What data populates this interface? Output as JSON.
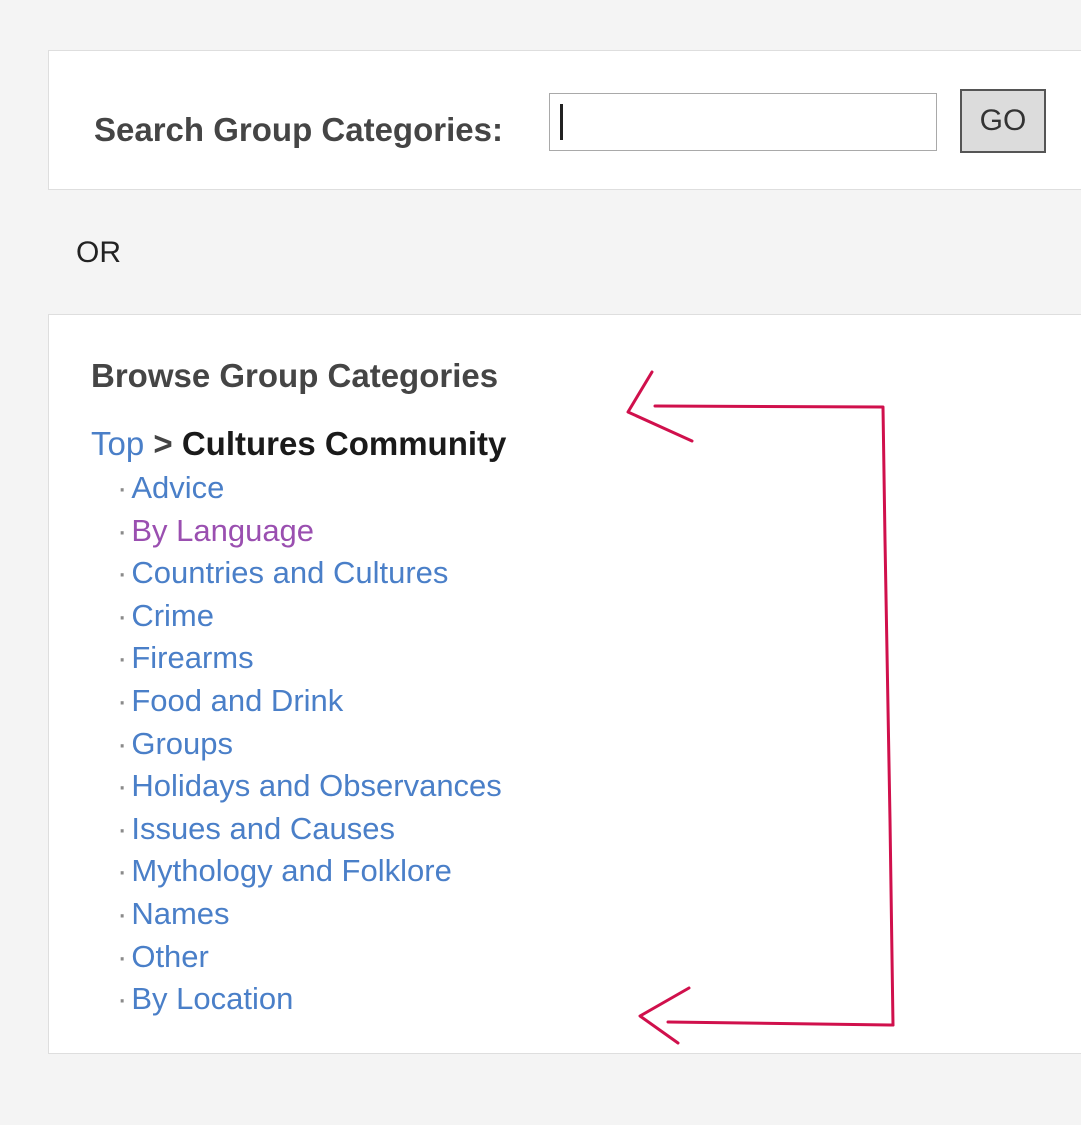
{
  "search": {
    "label": "Search Group Categories:",
    "value": "",
    "button_label": "GO"
  },
  "or_text": "OR",
  "browse": {
    "title": "Browse Group Categories",
    "breadcrumb": {
      "root": "Top",
      "separator": ">",
      "current": "Cultures Community"
    },
    "bullet": "·",
    "categories": [
      {
        "label": "Advice",
        "visited": false
      },
      {
        "label": "By Language",
        "visited": true
      },
      {
        "label": "Countries and Cultures",
        "visited": false
      },
      {
        "label": "Crime",
        "visited": false
      },
      {
        "label": "Firearms",
        "visited": false
      },
      {
        "label": "Food and Drink",
        "visited": false
      },
      {
        "label": "Groups",
        "visited": false
      },
      {
        "label": "Holidays and Observances",
        "visited": false
      },
      {
        "label": "Issues and Causes",
        "visited": false
      },
      {
        "label": "Mythology and Folklore",
        "visited": false
      },
      {
        "label": "Names",
        "visited": false
      },
      {
        "label": "Other",
        "visited": false
      },
      {
        "label": "By Location",
        "visited": false
      }
    ]
  },
  "colors": {
    "link": "#4a7fc8",
    "visited_link": "#9a4fb0",
    "annotation": "#d0104c"
  },
  "annotation": {
    "description_icon": "hand-drawn-bracket-arrow"
  }
}
